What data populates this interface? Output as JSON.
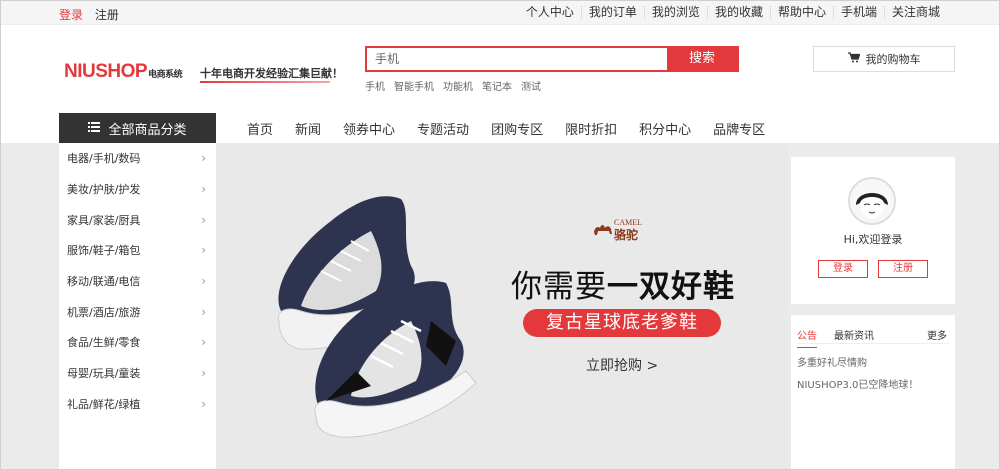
{
  "topbar": {
    "login": "登录",
    "register": "注册",
    "links": [
      "个人中心",
      "我的订单",
      "我的浏览",
      "我的收藏",
      "帮助中心",
      "手机端",
      "关注商城"
    ]
  },
  "header": {
    "logo": "NIUSHOP",
    "logo_sub": "电商系统",
    "slogan": "十年电商开发经验汇集巨献！",
    "search": {
      "value": "手机",
      "button": "搜索",
      "hot_words": [
        "手机",
        "智能手机",
        "功能机",
        "笔记本",
        "测试"
      ]
    },
    "cart_label": "我的购物车"
  },
  "nav": {
    "all_categories": "全部商品分类",
    "links": [
      "首页",
      "新闻",
      "领券中心",
      "专题活动",
      "团购专区",
      "限时折扣",
      "积分中心",
      "品牌专区"
    ]
  },
  "categories": [
    "电器/手机/数码",
    "美妆/护肤/护发",
    "家具/家装/厨具",
    "服饰/鞋子/箱包",
    "移动/联通/电信",
    "机票/酒店/旅游",
    "食品/生鲜/零食",
    "母婴/玩具/童装",
    "礼品/鲜花/绿植"
  ],
  "banner": {
    "brand_en": "CAMEL",
    "brand_cn": "骆驼",
    "headline_pre": "你需要",
    "headline_bold": "一双好鞋",
    "pill": "复古星球底老爹鞋",
    "cta": "立即抢购 >"
  },
  "user": {
    "welcome": "Hi,欢迎登录",
    "login_button": "登录",
    "register_button": "注册"
  },
  "news": {
    "tab_notice": "公告",
    "tab_latest": "最新资讯",
    "more": "更多",
    "items": [
      "多重好礼尽情购",
      "NIUSHOP3.0已空降地球！"
    ]
  },
  "colors": {
    "accent": "#e4393c",
    "dark": "#333333",
    "page_bg": "#ebebeb"
  },
  "icons": {
    "cart": "cart-icon",
    "menu": "menu-icon",
    "chevron": "chevron-right-icon"
  }
}
